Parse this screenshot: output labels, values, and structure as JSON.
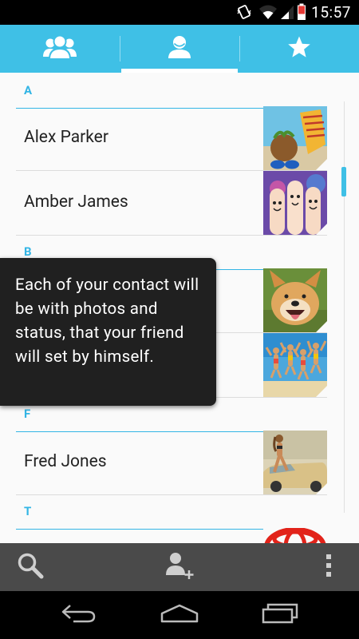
{
  "status_bar": {
    "time": "15:57",
    "icons": [
      "vibrate-icon",
      "wifi-icon",
      "cell-signal-icon",
      "battery-icon"
    ]
  },
  "tabs": [
    {
      "name": "groups",
      "icon": "groups-icon",
      "selected": false
    },
    {
      "name": "contacts",
      "icon": "person-icon",
      "selected": true
    },
    {
      "name": "favorites",
      "icon": "star-icon",
      "selected": false
    }
  ],
  "contacts": {
    "section_a": "A",
    "alex": "Alex Parker",
    "amber": "Amber James",
    "section_b": "B",
    "section_f": "F",
    "fred": "Fred Jones",
    "section_t": "T"
  },
  "tooltip": {
    "text": "Each of your contact will be with photos and status, that your friend will set by himself."
  },
  "bottom_bar": {
    "icons": [
      "search-icon",
      "add-contact-icon",
      "overflow-menu-icon"
    ]
  },
  "nav_bar": {
    "icons": [
      "back-icon",
      "home-icon",
      "recent-apps-icon"
    ]
  },
  "colors": {
    "accent": "#3fc0e6",
    "section_text": "#33b5e5",
    "tooltip_bg": "#202020",
    "bottom_bar": "#4a4a4a"
  }
}
